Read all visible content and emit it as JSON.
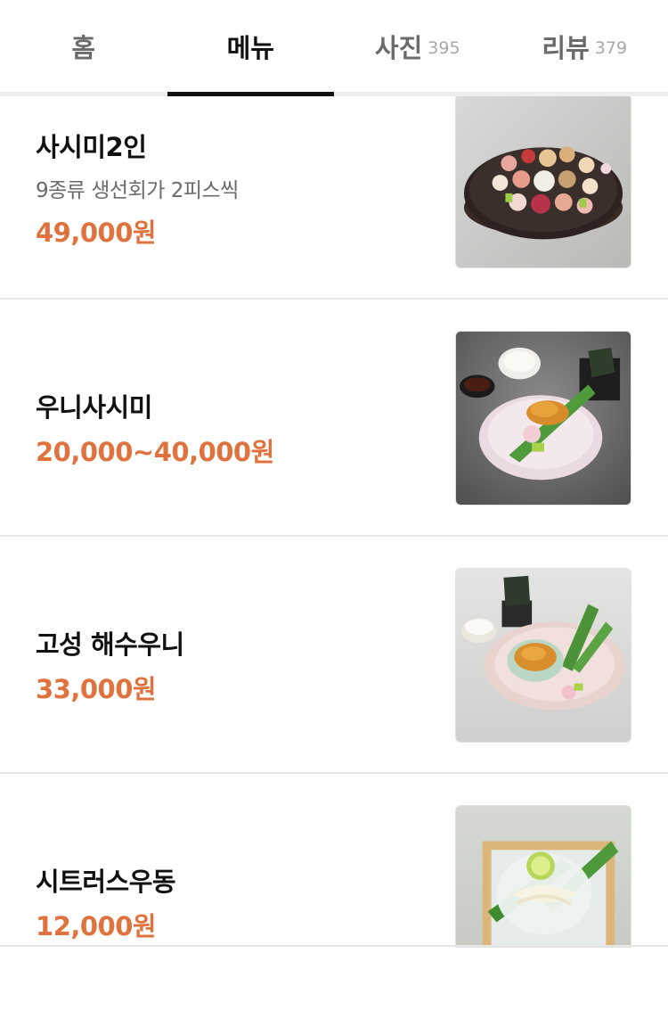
{
  "tabs": [
    {
      "label": "홈",
      "count": "",
      "active": false
    },
    {
      "label": "메뉴",
      "count": "",
      "active": true
    },
    {
      "label": "사진",
      "count": "395",
      "active": false
    },
    {
      "label": "리뷰",
      "count": "379",
      "active": false
    }
  ],
  "menu": {
    "items": [
      {
        "name": "사시미2인",
        "description": "9종류 생선회가 2피스씩",
        "price": "49,000원",
        "image": "sashimi-platter-photo"
      },
      {
        "name": "우니사시미",
        "price": "20,000~40,000원",
        "image": "uni-sashimi-photo"
      },
      {
        "name": "고성 해수우니",
        "price": "33,000원",
        "image": "goseong-uni-photo"
      },
      {
        "name": "시트러스우동",
        "price": "12,000원",
        "image": "citrus-udon-photo"
      }
    ]
  },
  "colors": {
    "price": "#e0723e",
    "active_tab": "#111111",
    "inactive_tab": "#6b6b6b"
  }
}
